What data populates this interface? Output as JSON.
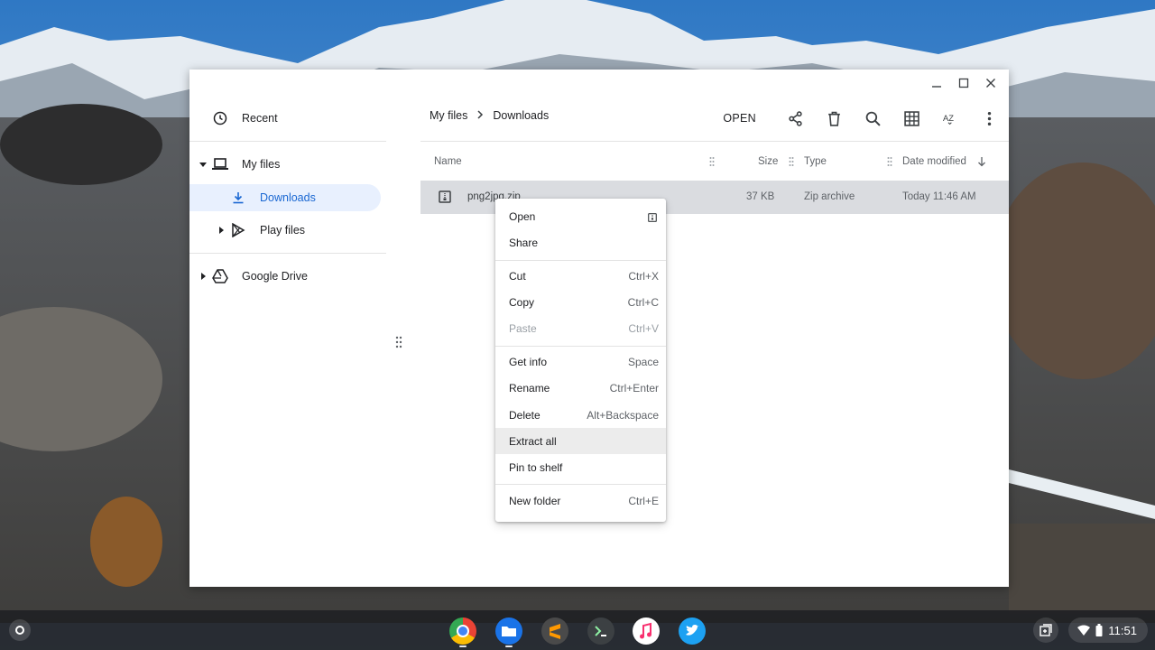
{
  "sidebar": {
    "recent": "Recent",
    "my_files": "My files",
    "downloads": "Downloads",
    "play_files": "Play files",
    "google_drive": "Google Drive"
  },
  "breadcrumb": {
    "root": "My files",
    "current": "Downloads"
  },
  "toolbar": {
    "open_label": "OPEN"
  },
  "columns": {
    "name": "Name",
    "size": "Size",
    "type": "Type",
    "date_modified": "Date modified"
  },
  "file_row": {
    "name": "png2jpg.zip",
    "size": "37 KB",
    "type": "Zip archive",
    "date": "Today 11:46 AM"
  },
  "context_menu": {
    "items": [
      {
        "label": "Open",
        "shortcut": ""
      },
      {
        "label": "Share",
        "shortcut": ""
      },
      {
        "label": "Cut",
        "shortcut": "Ctrl+X"
      },
      {
        "label": "Copy",
        "shortcut": "Ctrl+C"
      },
      {
        "label": "Paste",
        "shortcut": "Ctrl+V"
      },
      {
        "label": "Get info",
        "shortcut": "Space"
      },
      {
        "label": "Rename",
        "shortcut": "Ctrl+Enter"
      },
      {
        "label": "Delete",
        "shortcut": "Alt+Backspace"
      },
      {
        "label": "Extract all",
        "shortcut": ""
      },
      {
        "label": "Pin to shelf",
        "shortcut": ""
      },
      {
        "label": "New folder",
        "shortcut": "Ctrl+E"
      }
    ]
  },
  "shelf": {
    "apps": [
      "chrome-icon",
      "files-icon",
      "sublime-icon",
      "terminal-icon",
      "music-icon",
      "twitter-icon"
    ],
    "time": "11:51"
  },
  "colors": {
    "accent": "#1a73e8",
    "selected_bg": "#e8f0fe",
    "row_selected": "#dadce0"
  }
}
